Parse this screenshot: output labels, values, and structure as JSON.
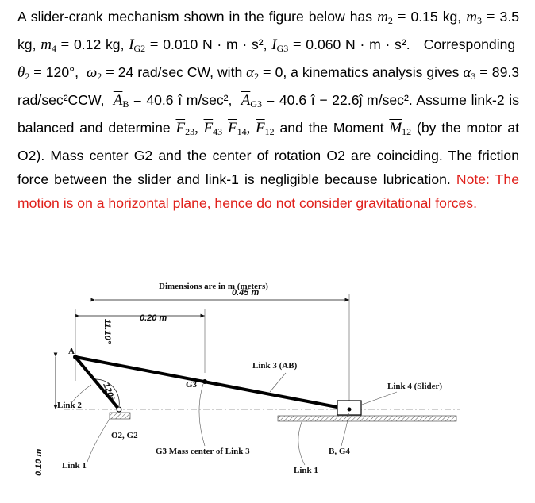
{
  "problem": {
    "intro": "A slider-crank mechanism shown in the figure below has",
    "givens": {
      "m2": "0.15 kg",
      "m3": "3.5 kg",
      "m4": "0.12 kg",
      "IG2": "0.010 N · m · s²",
      "IG3": "0.060 N · m · s²",
      "theta2": "120°",
      "omega2": "24 rad/sec CW",
      "alpha2": "0",
      "alpha3": "89.3 rad/sec²CCW",
      "AB": "40.6 î m/sec²",
      "AG3": "40.6 î − 22.6ĵ m/sec²"
    },
    "t_corresponding": "Corresponding",
    "t_with": ", with",
    "t_kin": ", a kinematics analysis gives",
    "t_assume": ". Assume link-2 is balanced and determine",
    "t_and": "and the Moment",
    "t_motor": "(by the motor at O2). Mass center G2 and the center of rotation O2 are coinciding. The friction force between the slider and link-1 is negligible because lubrication.",
    "note": "Note: The motion is on a horizontal plane, hence do not consider gravitational forces."
  },
  "figure": {
    "title": "Dimensions are in m (meters)",
    "dim_020": "0.20 m",
    "dim_045": "0.45 m",
    "dim_010": "0.10 m",
    "angle_1110": "11.10°",
    "angle_120": "120°",
    "label_A": "A",
    "label_G3": "G3",
    "label_link2": "Link 2",
    "label_link1_left": "Link 1",
    "label_link3": "Link 3 (AB)",
    "label_link4": "Link 4 (Slider)",
    "label_o2g2": "O2, G2",
    "label_g3_mass": "G3  Mass center of Link 3",
    "label_bg4": "B, G4",
    "label_link1_right": "Link 1"
  }
}
